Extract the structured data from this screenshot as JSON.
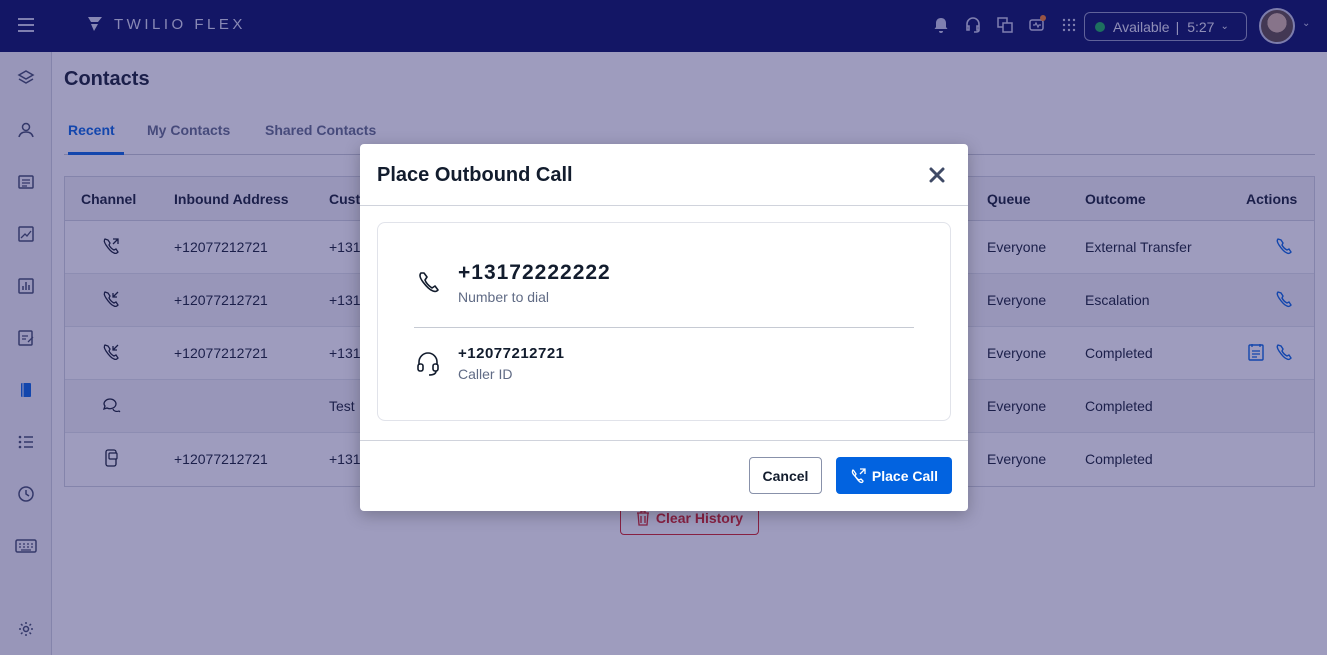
{
  "app": {
    "brand": "TWILIO FLEX"
  },
  "header": {
    "status_label": "Available",
    "status_separator": "|",
    "timer": "5:27",
    "icons": [
      "bell-icon",
      "headset-icon",
      "translate-icon",
      "activity-icon",
      "apps-grid-icon"
    ]
  },
  "sidebar": {
    "items": [
      "layers-icon",
      "agent-icon",
      "contacts-card-icon",
      "analytics-icon",
      "reports-icon",
      "tasks-icon",
      "phonebook-icon",
      "list-icon",
      "history-icon",
      "keyboard-icon",
      "settings-icon"
    ]
  },
  "page": {
    "title": "Contacts",
    "tabs": [
      "Recent",
      "My Contacts",
      "Shared Contacts"
    ],
    "active_tab": "Recent"
  },
  "table": {
    "columns": [
      "Channel",
      "Inbound Address",
      "Cust",
      "Queue",
      "Outcome",
      "Actions"
    ],
    "rows": [
      {
        "channel": "outbound-call-icon",
        "inbound": "+12077212721",
        "customer": "+131",
        "queue": "Everyone",
        "outcome": "External Transfer"
      },
      {
        "channel": "inbound-call-icon",
        "inbound": "+12077212721",
        "customer": "+131",
        "queue": "Everyone",
        "outcome": "Escalation"
      },
      {
        "channel": "inbound-call-icon",
        "inbound": "+12077212721",
        "customer": "+131",
        "queue": "Everyone",
        "outcome": "Completed"
      },
      {
        "channel": "chat-icon",
        "inbound": "",
        "customer": "Test",
        "queue": "Everyone",
        "outcome": "Completed"
      },
      {
        "channel": "sms-icon",
        "inbound": "+12077212721",
        "customer": "+131",
        "queue": "Everyone",
        "outcome": "Completed"
      }
    ]
  },
  "clear_history_label": "Clear History",
  "modal": {
    "title": "Place Outbound Call",
    "number": "+13172222222",
    "number_label": "Number to dial",
    "caller_id": "+12077212721",
    "caller_id_label": "Caller ID",
    "cancel_label": "Cancel",
    "place_call_label": "Place Call"
  },
  "colors": {
    "topbar": "#030b5d",
    "accent": "#0263e0",
    "danger": "#d61f1f",
    "available": "#14b053"
  }
}
